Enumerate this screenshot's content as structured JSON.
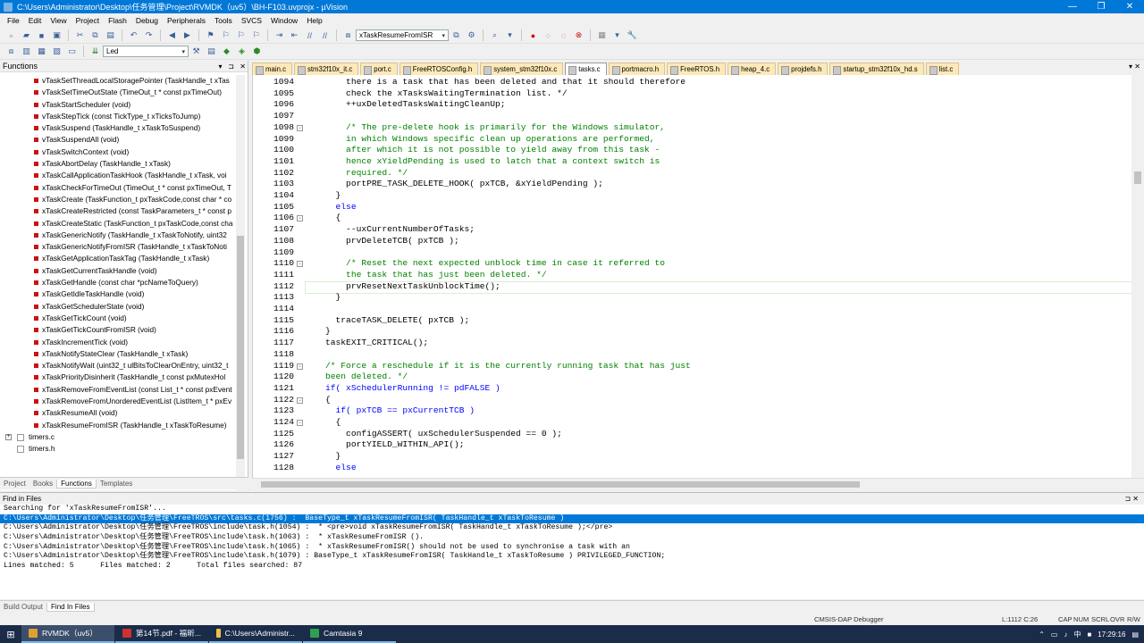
{
  "window": {
    "title": "C:\\Users\\Administrator\\Desktop\\任务管理\\Project\\RVMDK（uv5）\\BH-F103.uvprojx - µVision"
  },
  "menu": [
    "File",
    "Edit",
    "View",
    "Project",
    "Flash",
    "Debug",
    "Peripherals",
    "Tools",
    "SVCS",
    "Window",
    "Help"
  ],
  "toolbar": {
    "find_combo": "xTaskResumeFromISR",
    "target_combo": "Led"
  },
  "functions_panel": {
    "title": "Functions",
    "items": [
      "vTaskSetThreadLocalStoragePointer (TaskHandle_t xTas",
      "vTaskSetTimeOutState (TimeOut_t * const pxTimeOut)",
      "vTaskStartScheduler (void)",
      "vTaskStepTick (const TickType_t xTicksToJump)",
      "vTaskSuspend (TaskHandle_t xTaskToSuspend)",
      "vTaskSuspendAll (void)",
      "vTaskSwitchContext (void)",
      "xTaskAbortDelay (TaskHandle_t xTask)",
      "xTaskCallApplicationTaskHook (TaskHandle_t xTask, voi",
      "xTaskCheckForTimeOut (TimeOut_t * const pxTimeOut, T",
      "xTaskCreate (TaskFunction_t pxTaskCode,const char * co",
      "xTaskCreateRestricted (const TaskParameters_t * const p",
      "xTaskCreateStatic (TaskFunction_t pxTaskCode,const cha",
      "xTaskGenericNotify (TaskHandle_t xTaskToNotify, uint32",
      "xTaskGenericNotifyFromISR (TaskHandle_t xTaskToNoti",
      "xTaskGetApplicationTaskTag (TaskHandle_t xTask)",
      "xTaskGetCurrentTaskHandle (void)",
      "xTaskGetHandle (const char *pcNameToQuery)",
      "xTaskGetIdleTaskHandle (void)",
      "xTaskGetSchedulerState (void)",
      "xTaskGetTickCount (void)",
      "xTaskGetTickCountFromISR (void)",
      "xTaskIncrementTick (void)",
      "xTaskNotifyStateClear (TaskHandle_t xTask)",
      "xTaskNotifyWait (uint32_t ulBitsToClearOnEntry, uint32_t",
      "xTaskPriorityDisinherit (TaskHandle_t const pxMutexHol",
      "xTaskRemoveFromEventList (const List_t * const pxEvent",
      "xTaskRemoveFromUnorderedEventList (ListItem_t * pxEv",
      "xTaskResumeAll (void)",
      "xTaskResumeFromISR (TaskHandle_t xTaskToResume)"
    ],
    "files": [
      "timers.c",
      "timers.h"
    ],
    "tabs": [
      "Project",
      "Books",
      "Functions",
      "Templates"
    ]
  },
  "editor": {
    "tabs": [
      "main.c",
      "stm32f10x_it.c",
      "port.c",
      "FreeRTOSConfig.h",
      "system_stm32f10x.c",
      "tasks.c",
      "portmacro.h",
      "FreeRTOS.h",
      "heap_4.c",
      "projdefs.h",
      "startup_stm32f10x_hd.s",
      "list.c"
    ],
    "active_tab": "tasks.c",
    "line_numbers": [
      "1094",
      "1095",
      "1096",
      "1097",
      "1098",
      "1099",
      "1100",
      "1101",
      "1102",
      "1103",
      "1104",
      "1105",
      "1106",
      "1107",
      "1108",
      "1109",
      "1110",
      "1111",
      "1112",
      "1113",
      "1114",
      "1115",
      "1116",
      "1117",
      "1118",
      "1119",
      "1120",
      "1121",
      "1122",
      "1123",
      "1124",
      "1125",
      "1126",
      "1127",
      "1128"
    ],
    "code": [
      "        there is a task that has been deleted and that it should therefore",
      "        check the xTasksWaitingTermination list. */",
      "        ++uxDeletedTasksWaitingCleanUp;",
      "",
      "        /* The pre-delete hook is primarily for the Windows simulator,",
      "        in which Windows specific clean up operations are performed,",
      "        after which it is not possible to yield away from this task -",
      "        hence xYieldPending is used to latch that a context switch is",
      "        required. */",
      "        portPRE_TASK_DELETE_HOOK( pxTCB, &xYieldPending );",
      "      }",
      "      else",
      "      {",
      "        --uxCurrentNumberOfTasks;",
      "        prvDeleteTCB( pxTCB );",
      "",
      "        /* Reset the next expected unblock time in case it referred to",
      "        the task that has just been deleted. */",
      "        prvResetNextTaskUnblockTime();",
      "      }",
      "",
      "      traceTASK_DELETE( pxTCB );",
      "    }",
      "    taskEXIT_CRITICAL();",
      "",
      "    /* Force a reschedule if it is the currently running task that has just",
      "    been deleted. */",
      "    if( xSchedulerRunning != pdFALSE )",
      "    {",
      "      if( pxTCB == pxCurrentTCB )",
      "      {",
      "        configASSERT( uxSchedulerSuspended == 0 );",
      "        portYIELD_WITHIN_API();",
      "      }",
      "      else"
    ]
  },
  "find_panel": {
    "title": "Find in Files",
    "lines": [
      "Searching for 'xTaskResumeFromISR'...",
      "C:\\Users\\Administrator\\Desktop\\任务管理\\FreeTROS\\src\\tasks.c(1756) :  BaseType_t xTaskResumeFromISR( TaskHandle_t xTaskToResume )",
      "C:\\Users\\Administrator\\Desktop\\任务管理\\FreeTROS\\include\\task.h(1054) :  * <pre>void xTaskResumeFromISR( TaskHandle_t xTaskToResume );</pre>",
      "C:\\Users\\Administrator\\Desktop\\任务管理\\FreeTROS\\include\\task.h(1063) :  * xTaskResumeFromISR ().",
      "C:\\Users\\Administrator\\Desktop\\任务管理\\FreeTROS\\include\\task.h(1065) :  * xTaskResumeFromISR() should not be used to synchronise a task with an",
      "C:\\Users\\Administrator\\Desktop\\任务管理\\FreeTROS\\include\\task.h(1079) : BaseType_t xTaskResumeFromISR( TaskHandle_t xTaskToResume ) PRIVILEGED_FUNCTION;",
      "Lines matched: 5      Files matched: 2      Total files searched: 87"
    ],
    "tabs": [
      "Build Output",
      "Find In Files"
    ]
  },
  "status": {
    "debugger": "CMSIS-DAP Debugger",
    "position": "L:1112 C:26",
    "caps": "CAP",
    "num": "NUM",
    "scrl": "SCRL",
    "ovr": "OVR",
    "rw": "R/W"
  },
  "taskbar": {
    "items": [
      "RVMDK（uv5）",
      "第14节.pdf - 福昕...",
      "C:\\Users\\Administr...",
      "Camtasia 9"
    ],
    "time": "17:29:16"
  }
}
